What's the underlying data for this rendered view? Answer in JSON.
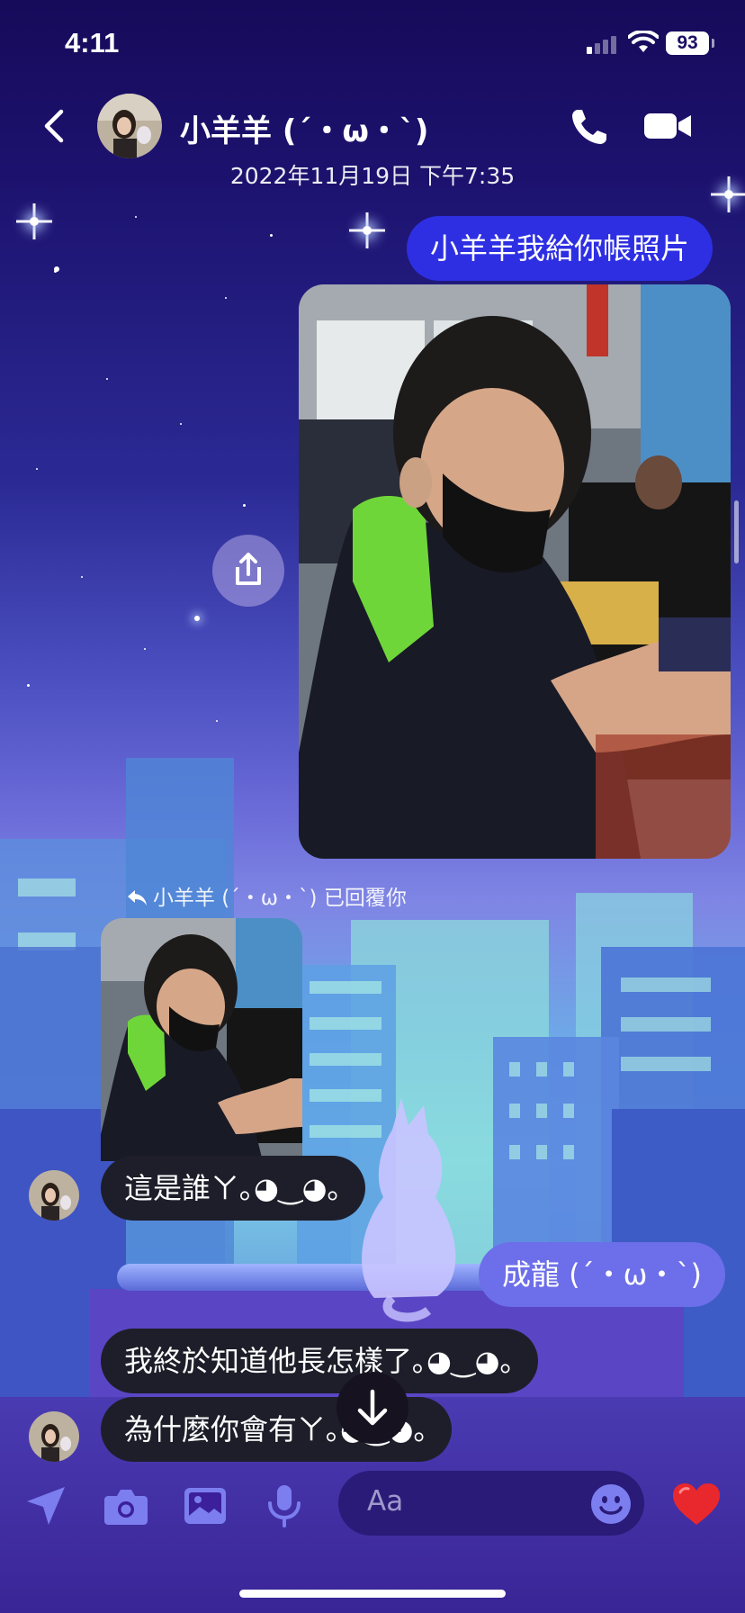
{
  "status_bar": {
    "time": "4:11",
    "battery": "93"
  },
  "header": {
    "contact_name": "小羊羊 (´・ω・`)"
  },
  "timestamp": "2022年11月19日 下午7:35",
  "messages": {
    "m1": "小羊羊我給你帳照片",
    "reply_note": "小羊羊 (´・ω・`) 已回覆你",
    "m2": "這是誰ㄚ｡◕‿◕｡",
    "m3": "成龍 (´・ω・`)",
    "m4": "我終於知道他長怎樣了｡◕‿◕｡",
    "m5": "為什麼你會有ㄚ｡◕‿◕｡"
  },
  "composer": {
    "placeholder": "Aa"
  },
  "colors": {
    "outgoing": "#2e2fe3",
    "outgoing_light": "#6d6ee9",
    "incoming": "#1e1e2a",
    "accent_heart": "#e8282d"
  },
  "icons": [
    "back-chevron-icon",
    "phone-icon",
    "video-camera-icon",
    "share-icon",
    "reply-arrow-icon",
    "arrow-down-icon",
    "location-arrow-icon",
    "camera-icon",
    "gallery-icon",
    "microphone-icon",
    "emoji-icon",
    "heart-icon"
  ]
}
